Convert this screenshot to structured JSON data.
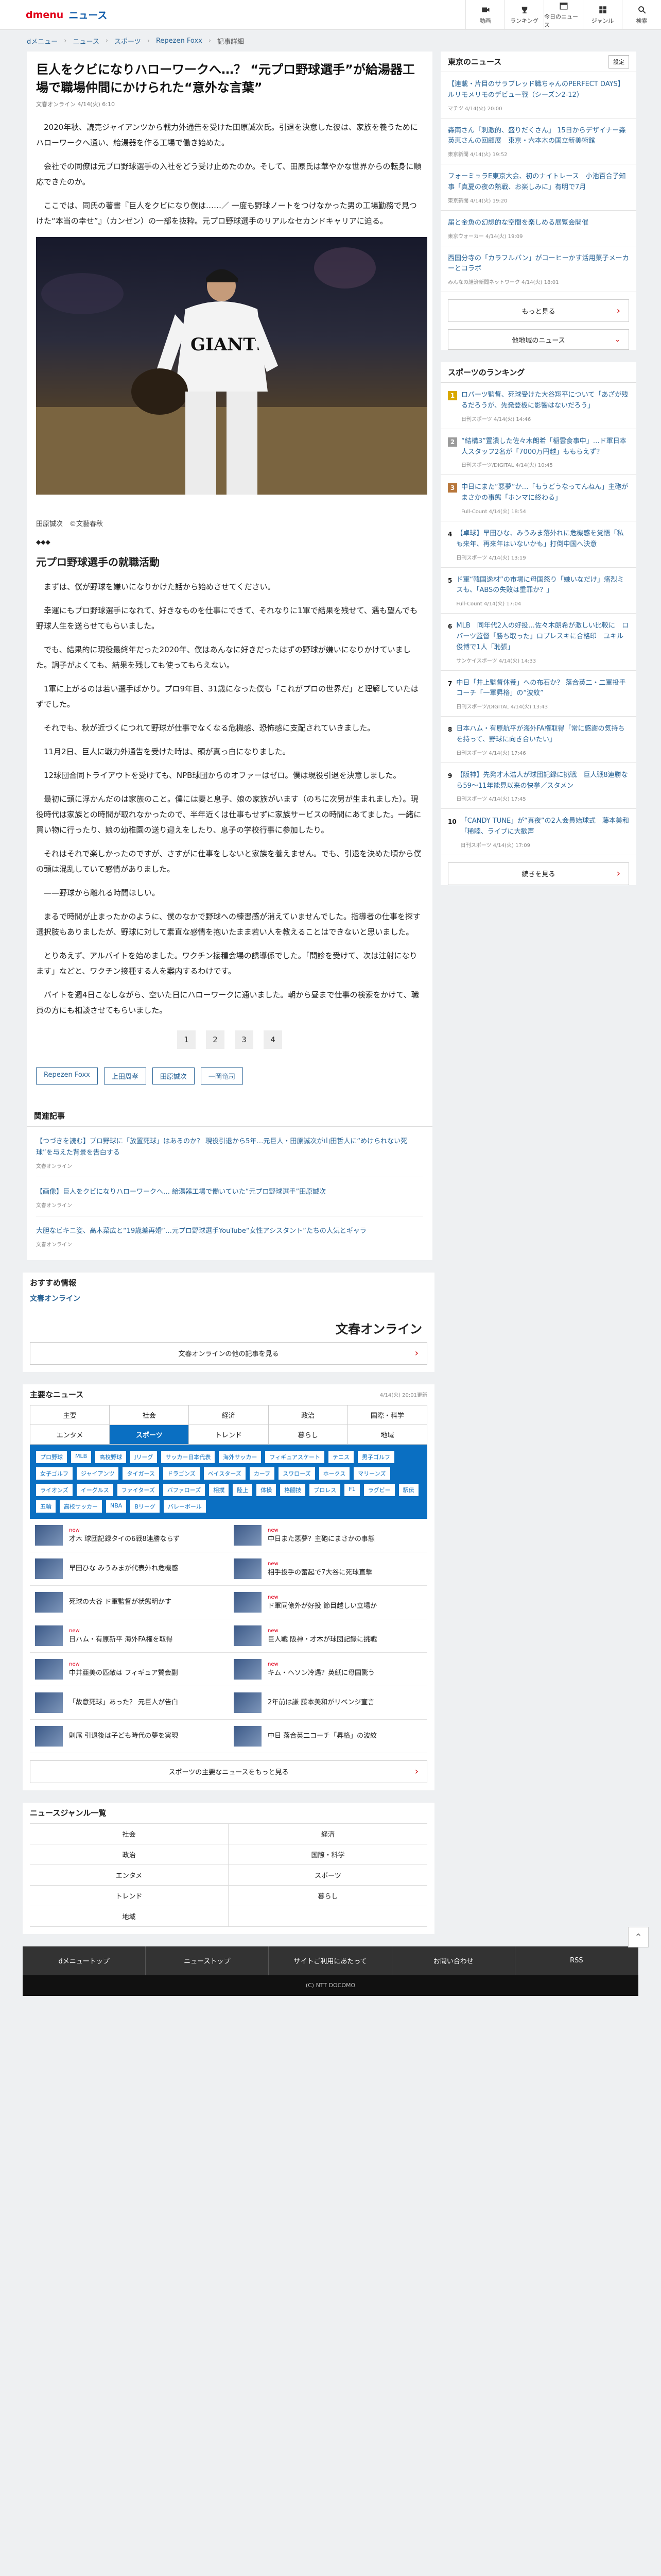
{
  "header": {
    "logo_brand": "dmenu",
    "logo_section": "ニュース",
    "nav": [
      {
        "label": "動画",
        "icon": "video-icon"
      },
      {
        "label": "ランキング",
        "icon": "ranking-icon"
      },
      {
        "label": "今日のニュース",
        "icon": "calendar-icon"
      },
      {
        "label": "ジャンル",
        "icon": "genre-icon"
      },
      {
        "label": "検索",
        "icon": "search-icon"
      }
    ]
  },
  "breadcrumb": [
    "dメニュー",
    "ニュース",
    "スポーツ",
    "Repezen Foxx",
    "記事詳細"
  ],
  "article": {
    "title": "巨人をクビになりハローワークへ…？ “元プロ野球選手”が給湯器工場で職場仲間にかけられた“意外な言葉”",
    "meta": "文春オンライン 4/14(火) 6:10",
    "intro": [
      "2020年秋、読売ジャイアンツから戦力外通告を受けた田原誠次氏。引退を決意した彼は、家族を養うためにハローワークへ通い、給湯器を作る工場で働き始めた。",
      "会社での同僚は元プロ野球選手の入社をどう受け止めたのか。そして、田原氏は華やかな世界からの転身に順応できたのか。",
      "ここでは、同氏の著書『巨人をクビになり僕は……／ 一度も野球ノートをつけなかった男の工場勤務で見つけた“本当の幸せ”』（カンゼン）の一部を抜粋。元プロ野球選手のリアルなセカンドキャリアに迫る。"
    ],
    "photo_caption": "田原誠次　©文藝春秋",
    "diamonds": "◆◆◆",
    "subheading": "元プロ野球選手の就職活動",
    "body": [
      "まずは、僕が野球を嫌いになりかけた話から始めさせてください。",
      "幸運にもプロ野球選手になれて、好きなものを仕事にできて、それなりに1軍で結果を残せて、遇も望んでも野球人生を送らせてもらいました。",
      "でも、結果的に現役最終年だった2020年、僕はあんなに好きだったはずの野球が嫌いになりかけていました。調子がよくても、結果を残しても使ってもらえない。",
      "1軍に上がるのは若い選手ばかり。プロ9年目、31歳になった僕も「これがプロの世界だ」と理解していたはずでした。",
      "それでも、秋が近づくにつれて野球が仕事でなくなる危機感、恐怖感に支配されていきました。",
      "11月2日、巨人に戦力外通告を受けた時は、頭が真っ白になりました。",
      "12球団合同トライアウトを受けても、NPB球団からのオファーはゼロ。僕は現役引退を決意しました。",
      "最初に頭に浮かんだのは家族のこと。僕には妻と息子、娘の家族がいます（のちに次男が生まれました）。現役時代は家族との時間が取れなかったので、半年近くは仕事もせずに家族サービスの時間にあてました。一緒に買い物に行ったり、娘の幼稚園の送り迎えをしたり、息子の学校行事に参加したり。",
      "それはそれで楽しかったのですが、さすがに仕事をしないと家族を養えません。でも、引退を決めた頃から僕の頭は混乱していて感情がありました。",
      "——野球から離れる時間ほしい。",
      "まるで時間が止まったかのように、僕のなかで野球への練習感が消えていませんでした。指導者の仕事を探す選択肢もありましたが、野球に対して素直な感情を抱いたまま若い人を教えることはできないと思いました。",
      "とりあえず、アルバイトを始めました。ワクチン接種会場の誘導係でした。「問診を受けて、次は注射になります」などと、ワクチン接種する人を案内するわけです。",
      "バイトを週4日こなしながら、空いた日にハローワークに通いました。朝から昼まで仕事の検索をかけて、職員の方にも相談させてもらいました。"
    ],
    "pages": [
      "1",
      "2",
      "3",
      "4"
    ],
    "tags": [
      "Repezen Foxx",
      "上田周孝",
      "田原誠次",
      "一岡竜司"
    ]
  },
  "related": {
    "heading": "関連記事",
    "items": [
      {
        "title": "【つづきを読む】プロ野球に「放置死球」はあるのか？ 現役引退から5年…元巨人・田原誠次が山田哲人に“めけられない死球”を与えた背景を告白する",
        "source": "文春オンライン"
      },
      {
        "title": "【画像】巨人をクビになりハローワークへ… 給湯器工場で働いていた“元プロ野球選手”田原誠次",
        "source": "文春オンライン"
      },
      {
        "title": "大胆なビキニ姿、髙木菜広と“19歳差再婚”…元プロ野球選手YouTube“女性アシスタント”たちの人気とギャラ",
        "source": "文春オンライン"
      }
    ]
  },
  "recommended": {
    "heading": "おすすめ情報",
    "publisher": "文春オンライン",
    "logo_text": "文春オンライン",
    "more_label": "文春オンラインの他の記事を見る"
  },
  "topnews": {
    "heading": "主要なニュース",
    "updated": "4/14(火) 20:01更新",
    "categories": [
      "主要",
      "社会",
      "経済",
      "政治",
      "国際・科学",
      "エンタメ",
      "スポーツ",
      "トレンド",
      "暮らし",
      "地域"
    ],
    "active_category": "スポーツ",
    "tags": [
      "プロ野球",
      "MLB",
      "高校野球",
      "Jリーグ",
      "サッカー日本代表",
      "海外サッカー",
      "フィギュアスケート",
      "テニス",
      "男子ゴルフ",
      "女子ゴルフ",
      "ジャイアンツ",
      "タイガース",
      "ドラゴンズ",
      "ベイスターズ",
      "カープ",
      "スワローズ",
      "ホークス",
      "マリーンズ",
      "ライオンズ",
      "イーグルス",
      "ファイターズ",
      "バファローズ",
      "相撲",
      "陸上",
      "体操",
      "格闘技",
      "プロレス",
      "F1",
      "ラグビー",
      "駅伝",
      "五輪",
      "高校サッカー",
      "NBA",
      "Bリーグ",
      "バレーボール"
    ],
    "items": [
      {
        "label": "才木 球団記録タイの6戦8連勝ならず",
        "new": "new"
      },
      {
        "label": "中日また悪夢？主砲にまさかの事態",
        "new": "new"
      },
      {
        "label": "早田ひな みうみまが代表外れ危機感",
        "new": ""
      },
      {
        "label": "相手投手の奮起で7大谷に死球直撃",
        "new": "new"
      },
      {
        "label": "死球の大谷 ド軍監督が状態明かす",
        "new": ""
      },
      {
        "label": "ド軍同僚外が好投 節目越しい立場か",
        "new": "new"
      },
      {
        "label": "日ハム・有原新平 海外FA権を取得",
        "new": "new"
      },
      {
        "label": "巨人戦 阪神・才木が球団記録に挑戦",
        "new": "new"
      },
      {
        "label": "中井亜美の匹敵は フィギュア賛会副",
        "new": "new"
      },
      {
        "label": "キム・ヘソン冷遇？英紙に母国驚う",
        "new": "new"
      },
      {
        "label": "「故意死球」あった？ 元巨人が告白",
        "new": ""
      },
      {
        "label": "2年前は謙 藤本美和がリベンジ宣言",
        "new": ""
      },
      {
        "label": "則尾 引退後は子ども時代の夢を実現",
        "new": ""
      },
      {
        "label": "中日 落合英二コーチ「昇格」の波紋",
        "new": ""
      }
    ],
    "more_label": "スポーツの主要なニュースをもっと見る"
  },
  "genres": {
    "heading": "ニュースジャンル一覧",
    "items": [
      "社会",
      "経済",
      "政治",
      "国際・科学",
      "エンタメ",
      "スポーツ",
      "トレンド",
      "暮らし",
      "地域",
      ""
    ]
  },
  "footer": {
    "links": [
      "dメニュートップ",
      "ニューストップ",
      "サイトご利用にあたって",
      "お問い合わせ",
      "RSS"
    ],
    "copyright": "(C) NTT DOCOMO"
  },
  "sidebar": {
    "tokyo": {
      "heading": "東京のニュース",
      "settings_label": "設定",
      "items": [
        {
          "title": "【連載・片目のサラブレッド職ちゃんのPERFECT DAYS】ルリモメリモのデビュー戦（シーズン2-12）",
          "source": "マチツ 4/14(火) 20:00"
        },
        {
          "title": "森南さん「刺激的、盛りだくさん」 15日からデザイナー森英恵さんの回顧展　東京・六本木の国立新美術館",
          "source": "東京新聞 4/14(火) 19:52"
        },
        {
          "title": "フォーミュラE東京大会、初のナイトレース　小池百合子知事「真夏の夜の熱戦、お楽しみに」有明で7月",
          "source": "東京新聞 4/14(火) 19:20"
        },
        {
          "title": "届と金魚の幻想的な空間を楽しめる展覧会開催",
          "source": "東京ウォーカー 4/14(火) 19:09"
        },
        {
          "title": "西国分寺の「カラフルパン」がコーヒーかす活用菓子メーカーとコラボ",
          "source": "みんなの経済新聞ネットワーク 4/14(火) 18:01"
        }
      ],
      "more_label": "もっと見る",
      "other_label": "他地域のニュース"
    },
    "ranking": {
      "heading": "スポーツのランキング",
      "items": [
        {
          "rank": "1",
          "title": "ロバーツ監督、死球受けた大谷翔平について「あざが残るだろうが、先発登板に影響はないだろう」",
          "source": "日刊スポーツ 4/14(火) 14:46"
        },
        {
          "rank": "2",
          "title": "“結構3”置潰した佐々木朗希「稲雲食事中」…ド軍日本人スタッフ2名が「7000万円越」ももらえず？",
          "source": "日刊スポーツ/DIGITAL 4/14(火) 10:45"
        },
        {
          "rank": "3",
          "title": "中日にまた“悪夢”か…「もうどうなってんねん」主砲がまさかの事態「ホンマに終わる」",
          "source": "Full-Count 4/14(火) 18:54"
        },
        {
          "rank": "4",
          "title": "【卓球】早田ひな、みうみま落外れに危機感を覚悟「私も来年、再来年はいないかも」打倒中国へ決意",
          "source": "日刊スポーツ 4/14(火) 13:19"
        },
        {
          "rank": "5",
          "title": "ド軍“韓国逸材”の市場に母国怒り「嫌いなだけ」痛烈ミスも、「ABSの失敗は重罪か？」",
          "source": "Full-Count 4/14(火) 17:04"
        },
        {
          "rank": "6",
          "title": "MLB　同年代2人の好投…佐々木朗希が激しい比較に　ロバーツ監督「勝ち取った」ロブレスキに合格印　ユキル俊博で1人「恥張」",
          "source": "サンケイスポーツ 4/14(火) 14:33"
        },
        {
          "rank": "7",
          "title": "中日「井上監督休養」への布石か？ 落合英二・二軍投手コーチ「一軍昇格」の“波紋”",
          "source": "日刊スポーツ/DIGITAL 4/14(火) 13:43"
        },
        {
          "rank": "8",
          "title": "日本ハム・有原航平が海外FA権取得「常に感謝の気持ちを持って、野球に向き合いたい」",
          "source": "日刊スポーツ 4/14(火) 17:46"
        },
        {
          "rank": "9",
          "title": "【阪神】先発才木浩人が球団記録に挑戦　巨人戦8連勝なら59〜11年能見以来の快挙／スタメン",
          "source": "日刊スポーツ 4/14(火) 17:45"
        },
        {
          "rank": "10",
          "title": "「CANDY TUNE」が“真夜”の2人会員始球式　藤本美和「稀睦、ライブに大歓声",
          "source": "日刊スポーツ 4/14(火) 17:09"
        }
      ],
      "more_label": "続きを見る"
    }
  }
}
